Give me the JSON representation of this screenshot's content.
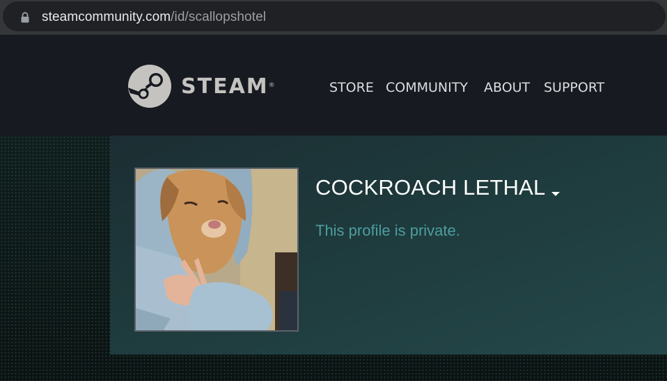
{
  "browser": {
    "url_host": "steamcommunity.com",
    "url_path": "/id/scallopshotel",
    "lock_icon": "lock-icon"
  },
  "header": {
    "logo_icon": "steam-logo-icon",
    "brand_name": "STEAM",
    "brand_mark": "®",
    "nav": [
      {
        "label": "STORE"
      },
      {
        "label": "COMMUNITY"
      },
      {
        "label": "ABOUT"
      },
      {
        "label": "SUPPORT"
      }
    ]
  },
  "profile": {
    "persona_name": "COCKROACH LETHAL",
    "dropdown_icon": "caret-down-icon",
    "status_message": "This profile is private.",
    "avatar": "avatar-dog-in-hoodie"
  },
  "colors": {
    "header_bg": "#171a21",
    "nav_text": "#dcdedf",
    "private_text": "#4d9ea0",
    "panel_accent": "#1e3a3c"
  }
}
